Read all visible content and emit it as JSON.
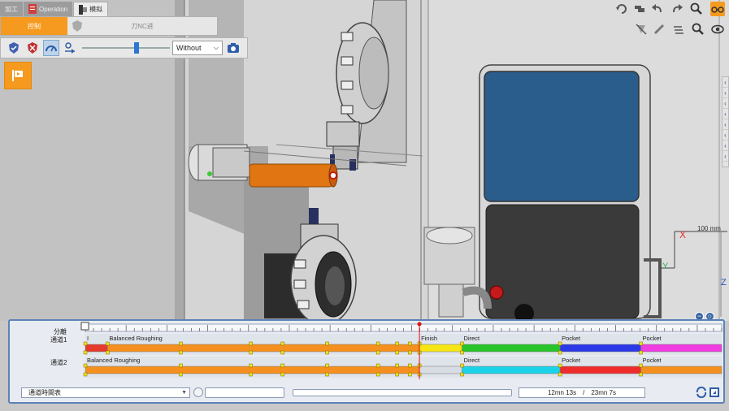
{
  "tabs": [
    {
      "label": "加工",
      "active": false
    },
    {
      "label": "Operation",
      "active": false
    },
    {
      "label": "模拟",
      "active": true
    }
  ],
  "panel": {
    "control_label": "控制",
    "nc_label": "刀NC进"
  },
  "toolbar": {
    "mode_value": "Without",
    "speed_fraction": 0.63
  },
  "viewport": {
    "scale_label": "100 mm",
    "axis_x": "X",
    "axis_y": "Y",
    "axis_z": "Z"
  },
  "timeline": {
    "header_label": "分離",
    "channel1_label": "通道1",
    "channel2_label": "通道2",
    "playhead_fraction": 0.525,
    "channel1_segments": [
      {
        "label": "I",
        "color": "#e53b2c",
        "start": 0.0,
        "end": 0.035
      },
      {
        "label": "Balanced Roughing",
        "color": "#f5901e",
        "start": 0.035,
        "end": 0.525
      },
      {
        "label": "Finish",
        "color": "#f5e614",
        "start": 0.525,
        "end": 0.592
      },
      {
        "label": "Direct",
        "color": "#27c42a",
        "start": 0.592,
        "end": 0.746
      },
      {
        "label": "Pocket",
        "color": "#2b39e6",
        "start": 0.746,
        "end": 0.873
      },
      {
        "label": "Pocket",
        "color": "#f03ce0",
        "start": 0.873,
        "end": 1.0
      }
    ],
    "channel2_segments": [
      {
        "label": "Balanced Roughing",
        "color": "#f5901e",
        "start": 0.0,
        "end": 0.525
      },
      {
        "label": "",
        "color": "#d8dce3",
        "start": 0.525,
        "end": 0.592
      },
      {
        "label": "Direct",
        "color": "#1ad3e8",
        "start": 0.592,
        "end": 0.746
      },
      {
        "label": "Pocket",
        "color": "#f02b2b",
        "start": 0.746,
        "end": 0.873
      },
      {
        "label": "Pocket",
        "color": "#f5901e",
        "start": 0.873,
        "end": 1.0
      }
    ],
    "channel_select": "通道時間表",
    "elapsed_time": "12mn 13s",
    "time_separator": "/",
    "total_time": "23mn 7s",
    "progress_fraction": 0.0
  }
}
